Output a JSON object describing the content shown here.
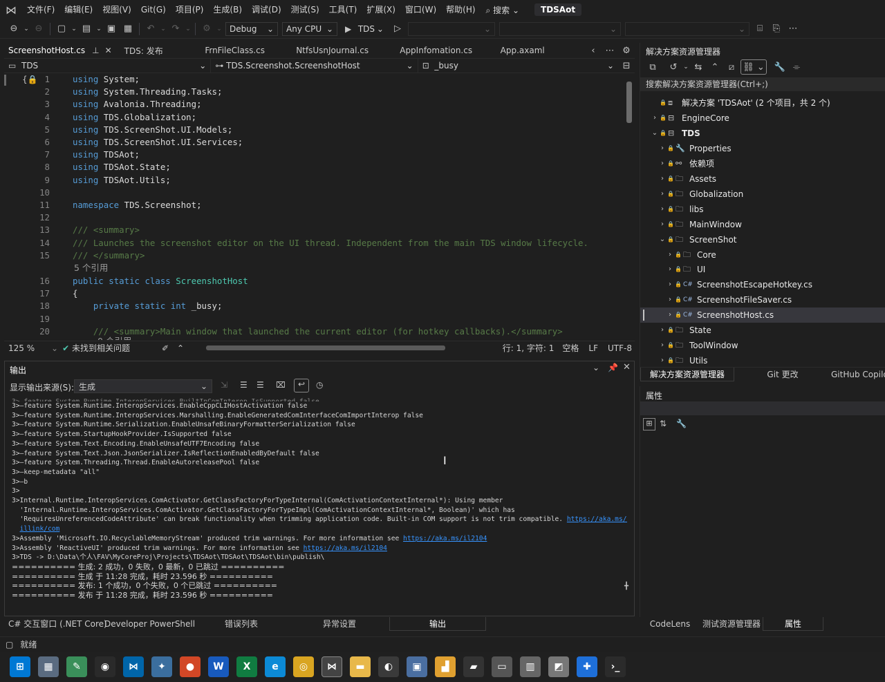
{
  "menu": {
    "items": [
      "文件(F)",
      "编辑(E)",
      "视图(V)",
      "Git(G)",
      "项目(P)",
      "生成(B)",
      "调试(D)",
      "测试(S)",
      "工具(T)",
      "扩展(X)",
      "窗口(W)",
      "帮助(H)"
    ],
    "search_label": "搜索",
    "solution_title": "TDSAot"
  },
  "toolbar": {
    "config": "Debug",
    "platform": "Any CPU",
    "start_label": "TDS"
  },
  "editor_tabs": [
    {
      "label": "ScreenshotHost.cs",
      "active": true
    },
    {
      "label": "TDS: 发布"
    },
    {
      "label": "FrnFileClass.cs"
    },
    {
      "label": "NtfsUsnJournal.cs"
    },
    {
      "label": "AppInfomation.cs"
    },
    {
      "label": "App.axaml"
    }
  ],
  "navbar": {
    "project": "TDS",
    "type": "TDS.Screenshot.ScreenshotHost",
    "member": "_busy"
  },
  "code": {
    "lines": [
      {
        "n": "1",
        "t": "using System;"
      },
      {
        "n": "2",
        "t": "using System.Threading.Tasks;"
      },
      {
        "n": "3",
        "t": "using Avalonia.Threading;"
      },
      {
        "n": "4",
        "t": "using TDS.Globalization;"
      },
      {
        "n": "5",
        "t": "using TDS.ScreenShot.UI.Models;"
      },
      {
        "n": "6",
        "t": "using TDS.ScreenShot.UI.Services;"
      },
      {
        "n": "7",
        "t": "using TDSAot;"
      },
      {
        "n": "8",
        "t": "using TDSAot.State;"
      },
      {
        "n": "9",
        "t": "using TDSAot.Utils;"
      },
      {
        "n": "10",
        "t": ""
      },
      {
        "n": "11",
        "t": "namespace TDS.Screenshot;"
      },
      {
        "n": "12",
        "t": ""
      },
      {
        "n": "13",
        "t": "/// <summary>"
      },
      {
        "n": "14",
        "t": "/// Launches the screenshot editor on the UI thread. Independent from the main TDS window lifecycle."
      },
      {
        "n": "15",
        "t": "/// </summary>"
      },
      {
        "n": "16",
        "t": "public static class ScreenshotHost"
      },
      {
        "n": "17",
        "t": "{"
      },
      {
        "n": "18",
        "t": "    private static int _busy;"
      },
      {
        "n": "19",
        "t": ""
      },
      {
        "n": "20",
        "t": "    /// <summary>Main window that launched the current editor (for hotkey callbacks).</summary>"
      }
    ],
    "refs_label": "5 个引用",
    "refs_partial": "0 个引用"
  },
  "editor_status": {
    "zoom": "125 %",
    "issues": "未找到相关问题",
    "position": "行: 1, 字符: 1",
    "whitespace": "空格",
    "eol": "LF",
    "encoding": "UTF-8"
  },
  "output": {
    "title": "输出",
    "source_label": "显示输出来源(S):",
    "source_value": "生成",
    "lines": [
      "3>—feature System.Runtime.InteropServices.EnableCppCLIHostActivation false",
      "3>—feature System.Runtime.InteropServices.Marshalling.EnableGeneratedComInterfaceComImportInterop false",
      "3>—feature System.Runtime.Serialization.EnableUnsafeBinaryFormatterSerialization false",
      "3>—feature System.StartupHookProvider.IsSupported false",
      "3>—feature System.Text.Encoding.EnableUnsafeUTF7Encoding false",
      "3>—feature System.Text.Json.JsonSerializer.IsReflectionEnabledByDefault false",
      "3>—feature System.Threading.Thread.EnableAutoreleasePool false",
      "3>—keep-metadata \"all\"",
      "3>—b",
      "3>",
      "3>Internal.Runtime.InteropServices.ComActivator.GetClassFactoryForTypeInternal(ComActivationContextInternal*): Using member",
      "  'Internal.Runtime.InteropServices.ComActivator.GetClassFactoryForTypeImpl(ComActivationContextInternal*, Boolean)' which has",
      "  'RequiresUnreferencedCodeAttribute' can break functionality when trimming application code. Built-in COM support is not trim compatible. "
    ],
    "link1a": "https://aka.ms/dotnet-",
    "link1b": "illink/com",
    "line_rs": "3>Assembly 'Microsoft.IO.RecyclableMemoryStream' produced trim warnings. For more information see ",
    "line_rui": "3>Assembly 'ReactiveUI' produced trim warnings. For more information see ",
    "link2": "https://aka.ms/il2104",
    "line_pub": "3>TDS -> D:\\Data\\个人\\FAV\\MyCoreProj\\Projects\\TDSAot\\TDSAot\\TDSAot\\bin\\publish\\",
    "summary": [
      "========== 生成: 2 成功，0 失败，0 最新，0 已跳过 ==========",
      "========== 生成 于 11:28 完成，耗时 23.596 秒 ==========",
      "========== 发布: 1 个成功，0 个失败，0 个已跳过 ==========",
      "========== 发布 于 11:28 完成，耗时 23.596 秒 =========="
    ]
  },
  "bottom_tabs": [
    "C# 交互窗口 (.NET Core)",
    "Developer PowerShell",
    "错误列表",
    "异常设置",
    "输出"
  ],
  "status": {
    "ready": "就绪"
  },
  "solution_explorer": {
    "title": "解决方案资源管理器",
    "search_placeholder": "搜索解决方案资源管理器(Ctrl+;)",
    "tree": [
      {
        "label": "解决方案 'TDSAot' (2 个项目，共 2 个)",
        "depth": 0,
        "chev": "",
        "icon": "solution-icon"
      },
      {
        "label": "EngineCore",
        "depth": 0,
        "chev": ">",
        "icon": "project-icon"
      },
      {
        "label": "TDS",
        "depth": 0,
        "chev": "v",
        "icon": "project-icon",
        "bold": true
      },
      {
        "label": "Properties",
        "depth": 1,
        "chev": ">",
        "icon": "properties-icon"
      },
      {
        "label": "依赖项",
        "depth": 1,
        "chev": ">",
        "icon": "dependencies-icon"
      },
      {
        "label": "Assets",
        "depth": 1,
        "chev": ">",
        "icon": "folder-icon"
      },
      {
        "label": "Globalization",
        "depth": 1,
        "chev": ">",
        "icon": "folder-icon"
      },
      {
        "label": "libs",
        "depth": 1,
        "chev": ">",
        "icon": "folder-icon"
      },
      {
        "label": "MainWindow",
        "depth": 1,
        "chev": ">",
        "icon": "folder-icon"
      },
      {
        "label": "ScreenShot",
        "depth": 1,
        "chev": "v",
        "icon": "folder-icon"
      },
      {
        "label": "Core",
        "depth": 2,
        "chev": ">",
        "icon": "folder-icon"
      },
      {
        "label": "UI",
        "depth": 2,
        "chev": ">",
        "icon": "folder-icon"
      },
      {
        "label": "ScreenshotEscapeHotkey.cs",
        "depth": 2,
        "chev": ">",
        "icon": "csharp-file-icon"
      },
      {
        "label": "ScreenshotFileSaver.cs",
        "depth": 2,
        "chev": ">",
        "icon": "csharp-file-icon"
      },
      {
        "label": "ScreenshotHost.cs",
        "depth": 2,
        "chev": ">",
        "icon": "csharp-file-icon",
        "selected": true
      },
      {
        "label": "State",
        "depth": 1,
        "chev": ">",
        "icon": "folder-icon"
      },
      {
        "label": "ToolWindow",
        "depth": 1,
        "chev": ">",
        "icon": "folder-icon"
      },
      {
        "label": "Utils",
        "depth": 1,
        "chev": ">",
        "icon": "folder-icon"
      }
    ],
    "tabs": [
      "解决方案资源管理器",
      "Git 更改",
      "GitHub Copilot"
    ]
  },
  "properties": {
    "title": "属性",
    "tabs": [
      "CodeLens",
      "测试资源管理器",
      "属性"
    ]
  },
  "taskbar": {
    "apps": [
      "start-icon",
      "calculator-icon",
      "notepad-icon",
      "obs-icon",
      "vscode-icon",
      "network-icon",
      "office-icon",
      "word-icon",
      "excel-icon",
      "edge-icon",
      "chrome-icon",
      "visual-studio-icon",
      "explorer-icon",
      "game-icon",
      "remote-desktop-icon",
      "gallery-icon",
      "box-icon",
      "monitor-icon",
      "chart-icon",
      "app-icon",
      "blue-app-icon",
      "terminal-icon"
    ]
  }
}
